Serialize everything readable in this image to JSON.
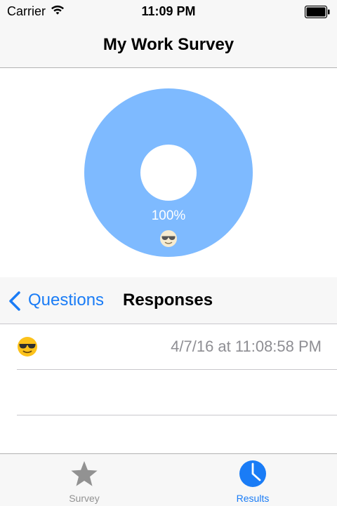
{
  "status_bar": {
    "carrier": "Carrier",
    "time": "11:09 PM",
    "wifi_icon": "wifi-icon",
    "battery_icon": "battery-icon"
  },
  "nav": {
    "title": "My Work Survey"
  },
  "chart_data": {
    "type": "pie",
    "variant": "donut",
    "slices": [
      {
        "label": "😎",
        "value": 100,
        "percent_label": "100%",
        "color": "#7ebaff"
      }
    ],
    "legend": "none"
  },
  "sub_nav": {
    "back_label": "Questions",
    "back_icon": "chevron-left-icon",
    "title": "Responses"
  },
  "responses": [
    {
      "emoji": "😎",
      "date": "4/7/16 at 11:08:58 PM"
    }
  ],
  "tabs": [
    {
      "label": "Survey",
      "icon": "star-icon",
      "active": false
    },
    {
      "label": "Results",
      "icon": "pie-chart-icon",
      "active": true
    }
  ],
  "colors": {
    "accent": "#1a7cf6",
    "inactive": "#929292",
    "bar_bg": "#f7f7f7",
    "pie": "#7ebaff"
  }
}
